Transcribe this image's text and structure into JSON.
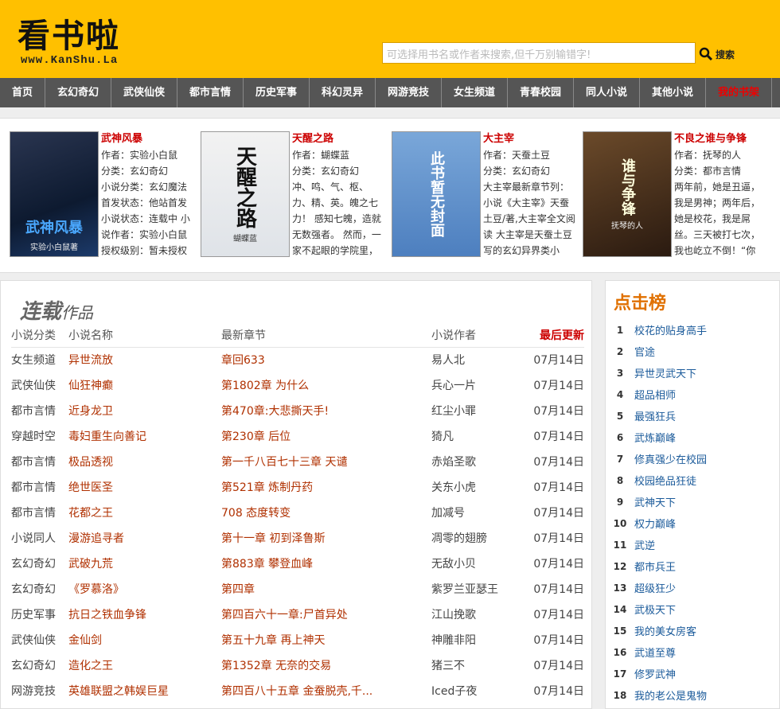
{
  "header": {
    "logo_text": "看书啦",
    "logo_url": "www.KanShu.La",
    "search_placeholder": "可选择用书名或作者来搜索,但千万别输错字!",
    "search_button": "搜索"
  },
  "nav": [
    "首页",
    "玄幻奇幻",
    "武侠仙侠",
    "都市言情",
    "历史军事",
    "科幻灵异",
    "网游竞技",
    "女生频道",
    "青春校园",
    "同人小说",
    "其他小说",
    "我的书架"
  ],
  "featured": [
    {
      "title": "武神风暴",
      "lines": [
        "作者：实验小白鼠",
        "分类：玄幻奇幻",
        "小说分类：玄幻魔法",
        "首发状态：他站首发",
        "小说状态：连载中 小",
        "说作者：实验小白鼠",
        "授权级别：暂未授权"
      ],
      "cover_text": "武神风暴",
      "cover_sub": "实验小白鼠著"
    },
    {
      "title": "天醒之路",
      "lines": [
        "作者：蝴蝶蓝",
        "分类：玄幻奇幻",
        "冲、鸣、气、枢、",
        "力、精、英。魄之七",
        "力！ 感知七魄，造就",
        "无数强者。 然而，一",
        "家不起眼的学院里，"
      ],
      "cover_text": "天醒之路",
      "cover_sub": "蝴蝶蓝"
    },
    {
      "title": "大主宰",
      "lines": [
        "作者：天蚕土豆",
        "分类：玄幻奇幻",
        "大主宰最新章节列：",
        "小说《大主宰》天蚕",
        "土豆/著,大主宰全文阅",
        "读 大主宰是天蚕土豆",
        "写的玄幻异界类小"
      ],
      "cover_text": "此书暂无封面"
    },
    {
      "title": "不良之谁与争锋",
      "lines": [
        "作者：抚琴的人",
        "分类：都市言情",
        "两年前，她是丑逼，",
        "我是男神；两年后，",
        "她是校花，我是屌",
        "丝。三天被打七次，",
        "我也屹立不倒！“你"
      ],
      "cover_text": "谁与争锋",
      "cover_sub": "抚琴的人"
    }
  ],
  "serial": {
    "title": "连载",
    "title_suffix": "作品",
    "headers": [
      "小说分类",
      "小说名称",
      "最新章节",
      "小说作者",
      "最后更新"
    ],
    "rows": [
      [
        "女生频道",
        "异世流放",
        "章回633",
        "易人北",
        "07月14日"
      ],
      [
        "武侠仙侠",
        "仙狂神癫",
        "第1802章 为什么",
        "兵心一片",
        "07月14日"
      ],
      [
        "都市言情",
        "近身龙卫",
        "第470章:大悲撕天手!",
        "红尘小罪",
        "07月14日"
      ],
      [
        "穿越时空",
        "毒妇重生向善记",
        "第230章 后位",
        "猗凡",
        "07月14日"
      ],
      [
        "都市言情",
        "极品透视",
        "第一千八百七十三章 天谴",
        "赤焰圣歌",
        "07月14日"
      ],
      [
        "都市言情",
        "绝世医圣",
        "第521章 炼制丹药",
        "关东小虎",
        "07月14日"
      ],
      [
        "都市言情",
        "花都之王",
        "708 态度转变",
        "加减号",
        "07月14日"
      ],
      [
        "小说同人",
        "漫游追寻者",
        "第十一章 初到泽鲁斯",
        "凋零的翅膀",
        "07月14日"
      ],
      [
        "玄幻奇幻",
        "武破九荒",
        "第883章 攀登血峰",
        "无敌小贝",
        "07月14日"
      ],
      [
        "玄幻奇幻",
        "《罗慕洛》",
        "第四章",
        "紫罗兰亚瑟王",
        "07月14日"
      ],
      [
        "历史军事",
        "抗日之铁血争锋",
        "第四百六十一章:尸首异处",
        "江山挽歌",
        "07月14日"
      ],
      [
        "武侠仙侠",
        "金仙剑",
        "第五十九章 再上神天",
        "神雕非阳",
        "07月14日"
      ],
      [
        "玄幻奇幻",
        "造化之王",
        "第1352章 无奈的交易",
        "猪三不",
        "07月14日"
      ],
      [
        "网游竞技",
        "英雄联盟之韩娱巨星",
        "第四百八十五章 金蚕脱壳,千...",
        "Iced子夜",
        "07月14日"
      ]
    ]
  },
  "ranking": {
    "title": "点击榜",
    "items": [
      [
        "1",
        "校花的贴身高手"
      ],
      [
        "2",
        "官途"
      ],
      [
        "3",
        "异世灵武天下"
      ],
      [
        "4",
        "超品相师"
      ],
      [
        "5",
        "最强狂兵"
      ],
      [
        "6",
        "武炼巅峰"
      ],
      [
        "7",
        "修真强少在校园"
      ],
      [
        "8",
        "校园绝品狂徒"
      ],
      [
        "9",
        "武神天下"
      ],
      [
        "10",
        "权力巅峰"
      ],
      [
        "11",
        "武逆"
      ],
      [
        "12",
        "都市兵王"
      ],
      [
        "13",
        "超级狂少"
      ],
      [
        "14",
        "武极天下"
      ],
      [
        "15",
        "我的美女房客"
      ],
      [
        "16",
        "武道至尊"
      ],
      [
        "17",
        "修罗武神"
      ],
      [
        "18",
        "我的老公是鬼物"
      ]
    ]
  },
  "colors": {
    "header": "#ffc000",
    "nav": "#555555",
    "link": "#b03000",
    "rank_link": "#1a5a9a",
    "accent": "#cc0000"
  }
}
